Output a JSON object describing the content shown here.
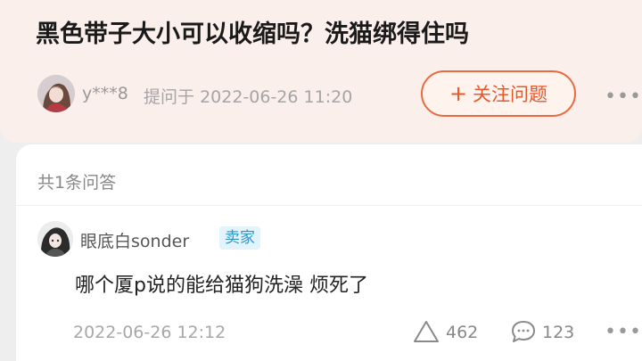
{
  "question": {
    "title": "黑色带子大小可以收缩吗？洗猫绑得住吗",
    "asker_name": "y***8",
    "asked_label": "提问于",
    "asked_time": "2022-06-26 11:20",
    "follow_button_label": "关注问题",
    "follow_button_icon": "plus-icon",
    "more_icon": "ellipsis-icon"
  },
  "answers": {
    "count_label": "共1条问答",
    "items": [
      {
        "author": "眼底白sonder",
        "badge": "卖家",
        "text": "哪个厦p说的能给猫狗洗澡 烦死了",
        "date": "2022-06-26 12:12",
        "likes": "462",
        "comments": "123",
        "like_icon": "thumb-up-triangle-icon",
        "comment_icon": "comment-bubble-icon",
        "more_icon": "ellipsis-icon"
      }
    ]
  },
  "colors": {
    "accent": "#e8572a",
    "question_bg": "#fbefeb",
    "badge_bg": "#e3f3fb",
    "badge_text": "#2f94c6"
  }
}
